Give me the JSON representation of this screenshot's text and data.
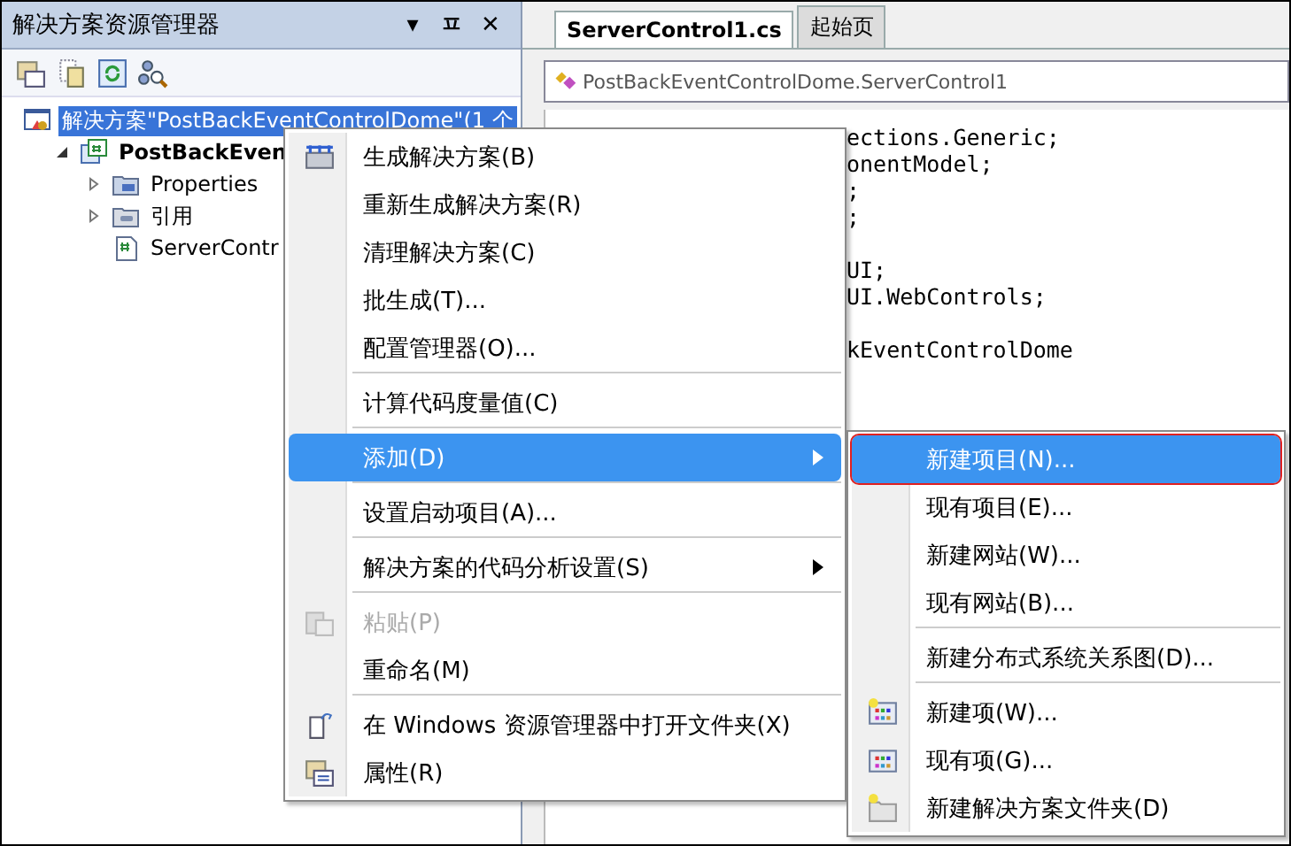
{
  "explorer": {
    "title": "解决方案资源管理器",
    "title_buttons": [
      "▾",
      "ㅍ",
      "✕"
    ],
    "tree": [
      {
        "label": "解决方案\"PostBackEventControlDome\"(1 个",
        "selected": true,
        "children": [
          {
            "label": "PostBackEven",
            "selected": false,
            "children": [
              {
                "label": "Properties",
                "selected": false,
                "expanded": false
              },
              {
                "label": "引用",
                "selected": false,
                "expanded": false
              },
              {
                "label": "ServerContr",
                "selected": false
              }
            ]
          }
        ]
      }
    ]
  },
  "editor": {
    "tabs": [
      {
        "label": "ServerControl1.cs",
        "selected": true
      },
      {
        "label": "起始页",
        "selected": false
      }
    ],
    "type_selector": "PostBackEventControlDome.ServerControl1",
    "code_blocks": [
      [
        "ections.Generic;",
        "onentModel;",
        ";",
        ";"
      ],
      [
        "UI;",
        "UI.WebControls;"
      ],
      [
        "kEventControlDome"
      ]
    ]
  },
  "context_menu": [
    {
      "kind": "item",
      "label": "生成解决方案(B)",
      "disabled": false,
      "selected": false,
      "submenu": false
    },
    {
      "kind": "item",
      "label": "重新生成解决方案(R)",
      "disabled": false,
      "selected": false,
      "submenu": false
    },
    {
      "kind": "item",
      "label": "清理解决方案(C)",
      "disabled": false,
      "selected": false,
      "submenu": false
    },
    {
      "kind": "item",
      "label": "批生成(T)...",
      "disabled": false,
      "selected": false,
      "submenu": false
    },
    {
      "kind": "item",
      "label": "配置管理器(O)...",
      "disabled": false,
      "selected": false,
      "submenu": false
    },
    {
      "kind": "separator"
    },
    {
      "kind": "item",
      "label": "计算代码度量值(C)",
      "disabled": false,
      "selected": false,
      "submenu": false
    },
    {
      "kind": "separator"
    },
    {
      "kind": "item",
      "label": "添加(D)",
      "disabled": false,
      "selected": true,
      "submenu": true
    },
    {
      "kind": "separator"
    },
    {
      "kind": "item",
      "label": "设置启动项目(A)...",
      "disabled": false,
      "selected": false,
      "submenu": false
    },
    {
      "kind": "separator"
    },
    {
      "kind": "item",
      "label": "解决方案的代码分析设置(S)",
      "disabled": false,
      "selected": false,
      "submenu": true
    },
    {
      "kind": "separator"
    },
    {
      "kind": "item",
      "label": "粘贴(P)",
      "disabled": true,
      "selected": false,
      "submenu": false
    },
    {
      "kind": "item",
      "label": "重命名(M)",
      "disabled": false,
      "selected": false,
      "submenu": false
    },
    {
      "kind": "separator"
    },
    {
      "kind": "item",
      "label": "在 Windows 资源管理器中打开文件夹(X)",
      "disabled": false,
      "selected": false,
      "submenu": false
    },
    {
      "kind": "item",
      "label": "属性(R)",
      "disabled": false,
      "selected": false,
      "submenu": false
    }
  ],
  "add_submenu": [
    {
      "kind": "item",
      "label": "新建项目(N)...",
      "selected": true,
      "outlined": true
    },
    {
      "kind": "item",
      "label": "现有项目(E)...",
      "selected": false,
      "outlined": false
    },
    {
      "kind": "item",
      "label": "新建网站(W)...",
      "selected": false,
      "outlined": false
    },
    {
      "kind": "item",
      "label": "现有网站(B)...",
      "selected": false,
      "outlined": false
    },
    {
      "kind": "separator"
    },
    {
      "kind": "item",
      "label": "新建分布式系统关系图(D)...",
      "selected": false,
      "outlined": false
    },
    {
      "kind": "separator"
    },
    {
      "kind": "item",
      "label": "新建项(W)...",
      "selected": false,
      "outlined": false
    },
    {
      "kind": "item",
      "label": "现有项(G)...",
      "selected": false,
      "outlined": false
    },
    {
      "kind": "item",
      "label": "新建解决方案文件夹(D)",
      "selected": false,
      "outlined": false
    }
  ]
}
